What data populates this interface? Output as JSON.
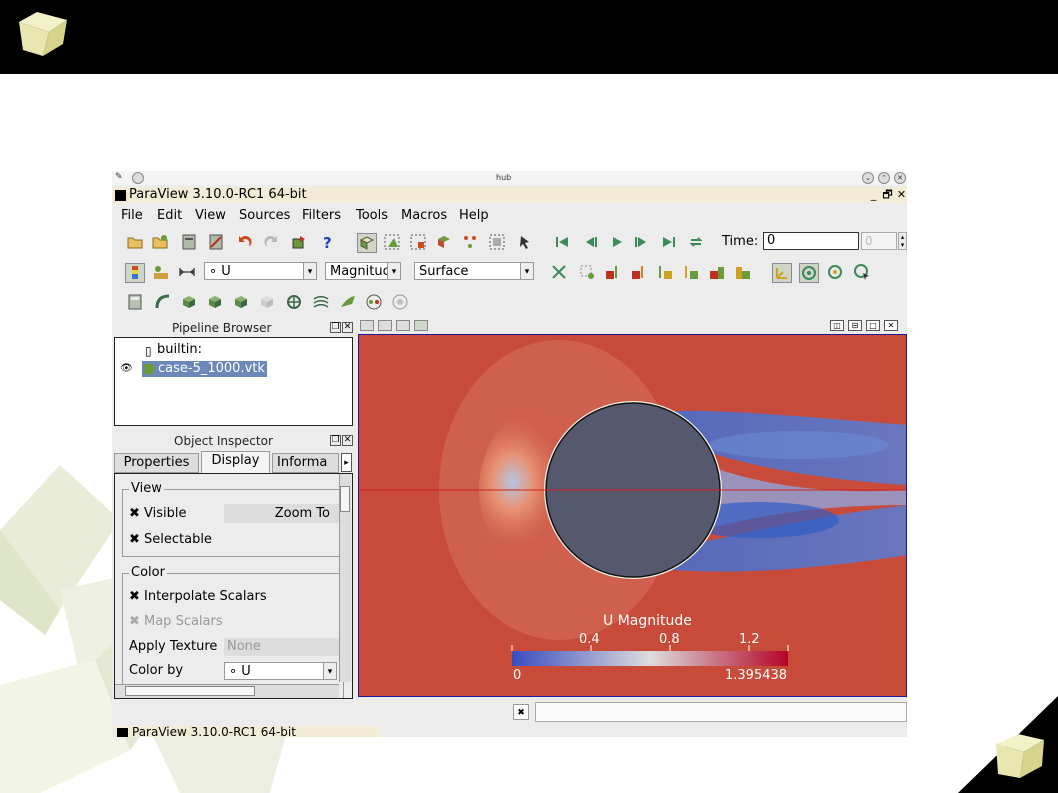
{
  "window_manager": {
    "title": "hub"
  },
  "app": {
    "title": "ParaView 3.10.0-RC1 64-bit",
    "controls": [
      "_",
      "🗗",
      "✕"
    ]
  },
  "menu": [
    "File",
    "Edit",
    "View",
    "Sources",
    "Filters",
    "Tools",
    "Macros",
    "Help"
  ],
  "toolbar": {
    "time_label": "Time:",
    "time_value": "0",
    "time_step": "0",
    "color_array": "∘ U",
    "component": "Magnituc",
    "representation": "Surface"
  },
  "pipeline_browser": {
    "header": "Pipeline Browser",
    "items": [
      {
        "label": "builtin:"
      },
      {
        "label": "case-5_1000.vtk"
      }
    ]
  },
  "object_inspector": {
    "header": "Object Inspector",
    "tabs": [
      "Properties",
      "Display",
      "Informa"
    ],
    "active_tab": "Display",
    "view_group": {
      "label": "View",
      "visible_label": "Visible",
      "zoom_button": "Zoom To",
      "selectable_label": "Selectable"
    },
    "color_group": {
      "label": "Color",
      "interpolate_label": "Interpolate Scalars",
      "map_scalars_label": "Map Scalars",
      "apply_texture_label": "Apply Texture",
      "apply_texture_value": "None",
      "color_by_label": "Color by",
      "color_by_value": "∘ U"
    }
  },
  "viewport": {
    "legend": {
      "title": "U Magnitude",
      "ticks": [
        "0.4",
        "0.8",
        "1.2"
      ],
      "min": "0",
      "max": "1.395438"
    }
  },
  "taskbar": {
    "label": "ParaView 3.10.0-RC1 64-bit"
  },
  "colors": {
    "topbar": "#000000",
    "title_bar": "#f2ecd6",
    "cylinder": "#56596e",
    "background_flow": "#c84b3a",
    "wake": "#3c6cd0"
  }
}
